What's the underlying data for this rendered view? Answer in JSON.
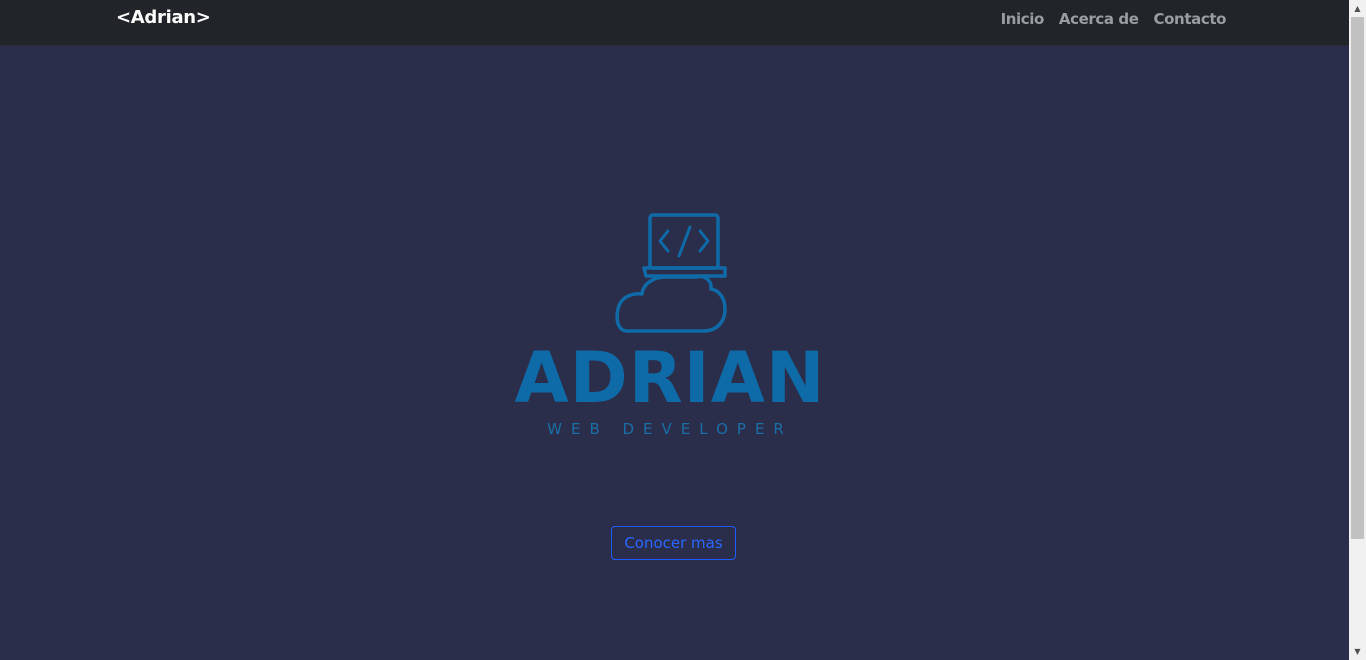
{
  "navbar": {
    "brand": "<Adrian>",
    "links": [
      "Inicio",
      "Acerca de",
      "Contacto"
    ]
  },
  "hero": {
    "logo_title": "ADRIAN",
    "logo_subtitle": "WEB DEVELOPER",
    "logo_icon": "cloud-laptop-code-icon",
    "cta_label": "Conocer mas"
  },
  "colors": {
    "background": "#2b2e4a",
    "navbar": "#212529",
    "logo": "#0f6aa8",
    "cta": "#2a66ff"
  }
}
